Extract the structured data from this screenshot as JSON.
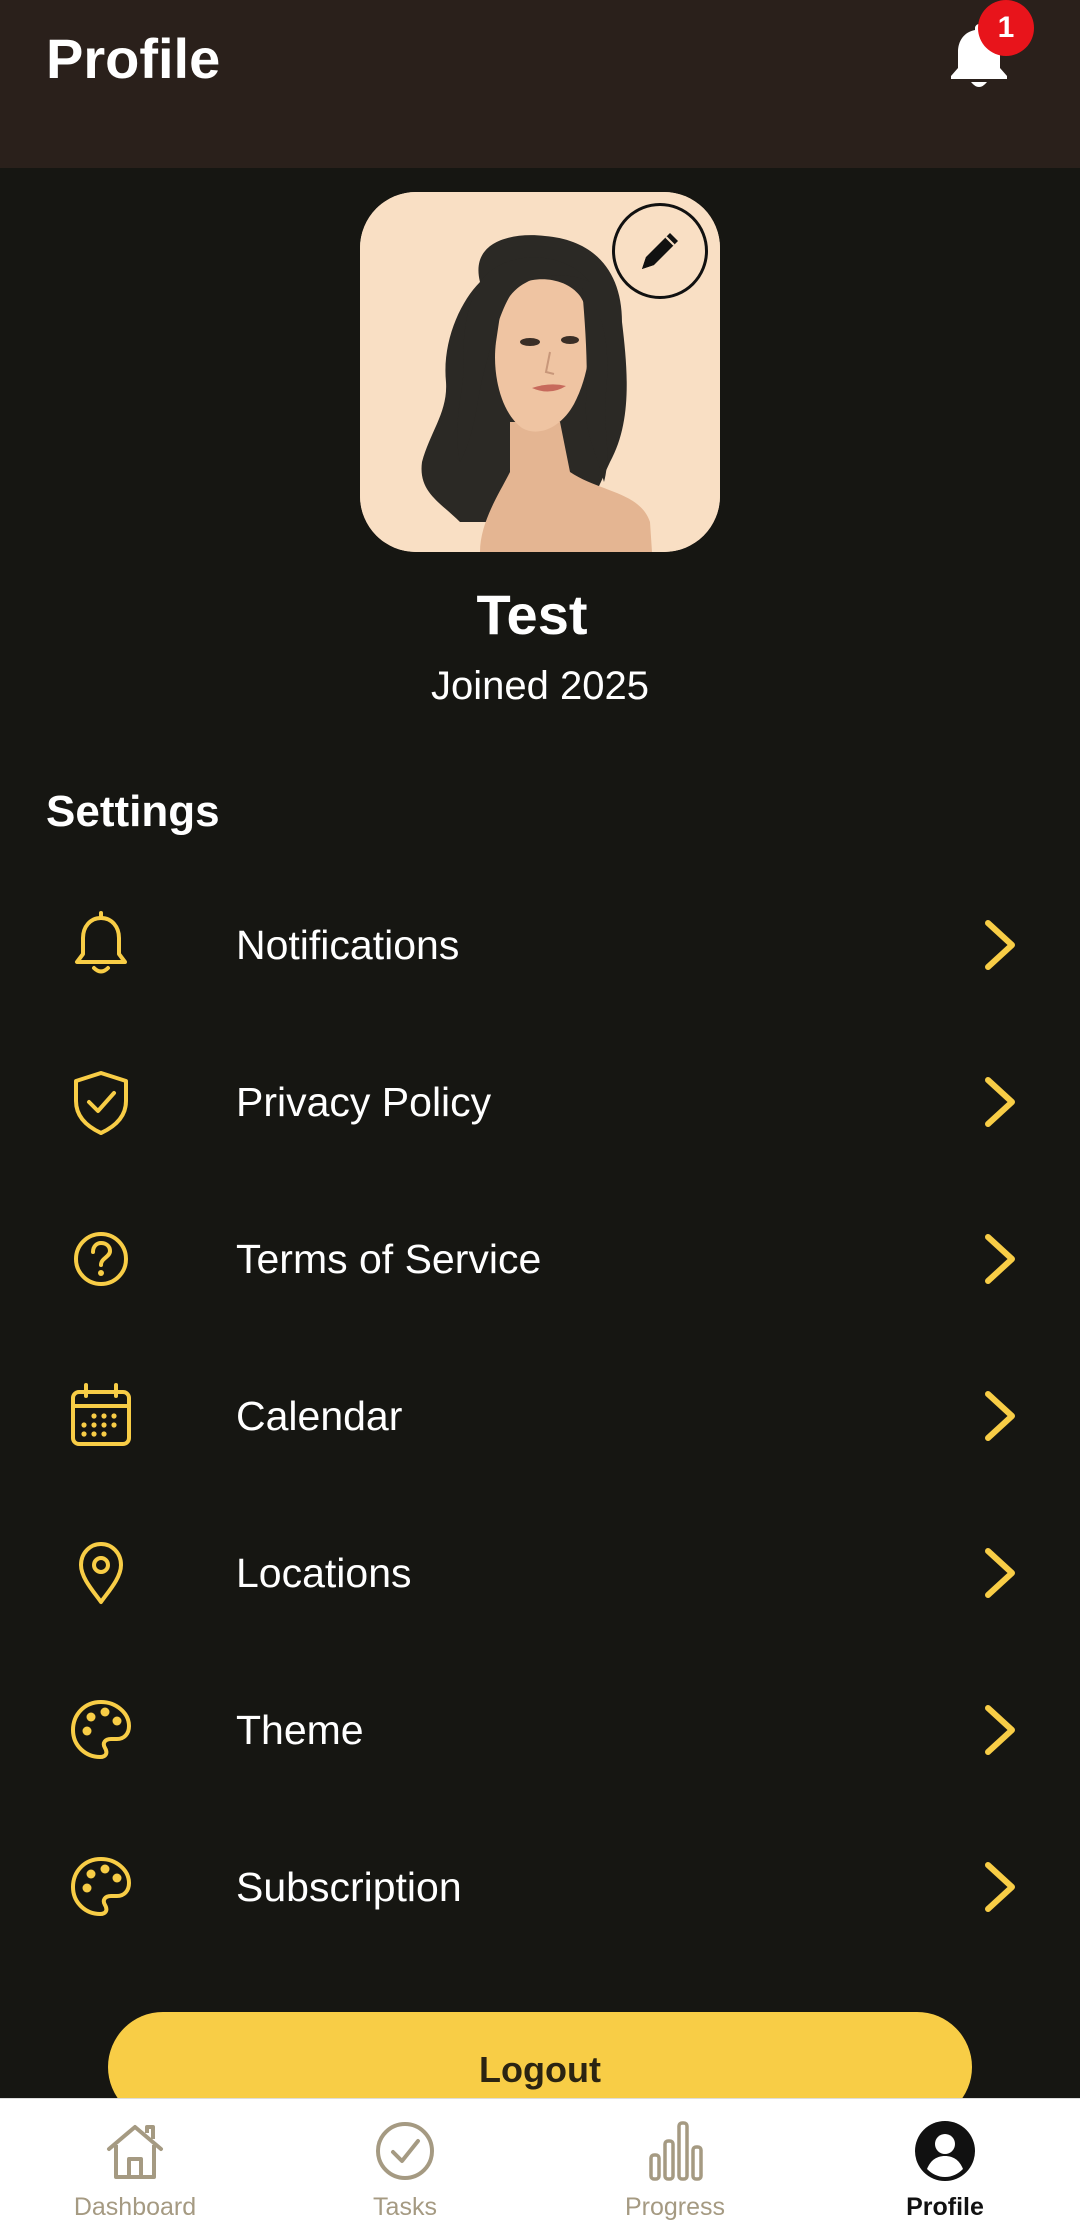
{
  "header": {
    "title": "Profile",
    "notification_count": "1"
  },
  "profile": {
    "name": "Test",
    "joined": "Joined 2025"
  },
  "settings": {
    "title": "Settings",
    "items": [
      {
        "label": "Notifications",
        "icon": "bell-icon"
      },
      {
        "label": "Privacy Policy",
        "icon": "shield-check-icon"
      },
      {
        "label": "Terms of Service",
        "icon": "help-circle-icon"
      },
      {
        "label": "Calendar",
        "icon": "calendar-icon"
      },
      {
        "label": "Locations",
        "icon": "map-pin-icon"
      },
      {
        "label": "Theme",
        "icon": "palette-icon"
      },
      {
        "label": "Subscription",
        "icon": "palette-icon"
      }
    ]
  },
  "logout_label": "Logout",
  "tabs": [
    {
      "label": "Dashboard",
      "icon": "home-icon",
      "active": false
    },
    {
      "label": "Tasks",
      "icon": "check-circle-icon",
      "active": false
    },
    {
      "label": "Progress",
      "icon": "bar-chart-icon",
      "active": false
    },
    {
      "label": "Profile",
      "icon": "user-circle-icon",
      "active": true
    }
  ],
  "colors": {
    "header_bg": "#2a201b",
    "background": "#161612",
    "accent": "#f8cd46",
    "badge": "#e8141b",
    "tab_inactive": "#a59a82"
  }
}
